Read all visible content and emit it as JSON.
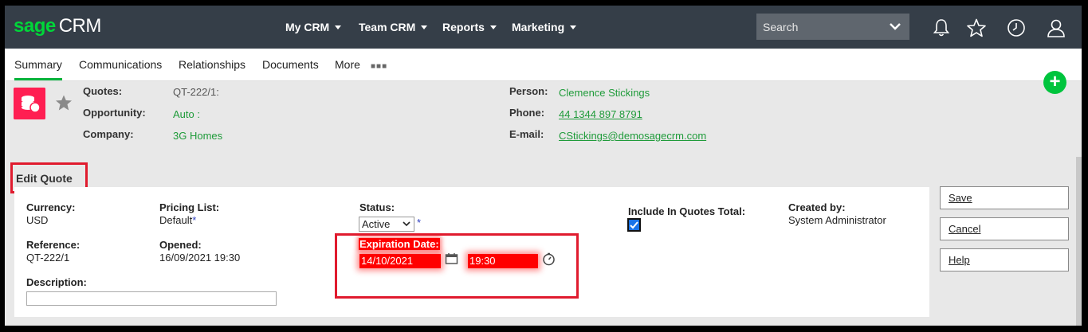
{
  "app": {
    "logo_sage": "sage",
    "logo_crm": "CRM"
  },
  "nav": [
    {
      "label": "My CRM"
    },
    {
      "label": "Team CRM"
    },
    {
      "label": "Reports"
    },
    {
      "label": "Marketing"
    }
  ],
  "search": {
    "placeholder": "Search"
  },
  "top_icons": [
    "bell-icon",
    "star-icon",
    "clock-icon",
    "user-icon"
  ],
  "tabs": [
    {
      "label": "Summary",
      "active": true
    },
    {
      "label": "Communications"
    },
    {
      "label": "Relationships"
    },
    {
      "label": "Documents"
    },
    {
      "label": "More"
    }
  ],
  "summary": {
    "quotes_label": "Quotes:",
    "quotes_value": "QT-222/1:",
    "opportunity_label": "Opportunity:",
    "opportunity_value": "Auto :",
    "company_label": "Company:",
    "company_value": "3G Homes",
    "person_label": "Person:",
    "person_value": "Clemence Stickings",
    "phone_label": "Phone:",
    "phone_value": "44 1344 897 8791",
    "email_label": "E-mail:",
    "email_value": "CStickings@demosagecrm.com"
  },
  "edit": {
    "title": "Edit Quote",
    "currency_label": "Currency:",
    "currency_value": "USD",
    "pricing_label": "Pricing List:",
    "pricing_value": "Default",
    "required_mark": "*",
    "status_label": "Status:",
    "status_value": "Active",
    "include_label": "Include In Quotes Total:",
    "include_checked": true,
    "created_label": "Created by:",
    "created_value": "System Administrator",
    "reference_label": "Reference:",
    "reference_value": "QT-222/1",
    "opened_label": "Opened:",
    "opened_value": "16/09/2021 19:30",
    "expiration_label": "Expiration Date:",
    "expiration_date": "14/10/2021",
    "expiration_time": "19:30",
    "description_label": "Description:",
    "description_value": ""
  },
  "actions": {
    "save": "Save",
    "cancel": "Cancel",
    "help": "Help"
  },
  "colors": {
    "topbar": "#353e48",
    "brand_green": "#00d639",
    "link_green": "#1f9b3a",
    "highlight_red": "#e01b2e",
    "quote_icon": "#ff1e52"
  }
}
